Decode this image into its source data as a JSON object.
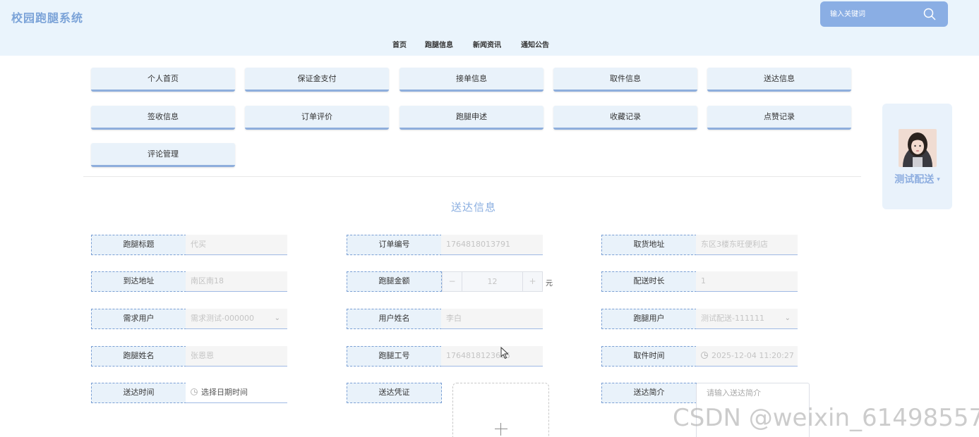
{
  "app": {
    "title": "校园跑腿系统"
  },
  "search": {
    "placeholder": "输入关键词"
  },
  "nav": [
    "首页",
    "跑腿信息",
    "新闻资讯",
    "通知公告"
  ],
  "menu": [
    "个人首页",
    "保证金支付",
    "接单信息",
    "取件信息",
    "送达信息",
    "签收信息",
    "订单评价",
    "跑腿申述",
    "收藏记录",
    "点赞记录",
    "评论管理"
  ],
  "user": {
    "name": "测试配送"
  },
  "form": {
    "title": "送达信息",
    "fields": [
      {
        "label": "跑腿标题",
        "value": "代买"
      },
      {
        "label": "订单编号",
        "value": "1764818013791"
      },
      {
        "label": "取货地址",
        "value": "东区3楼东旺便利店"
      },
      {
        "label": "到达地址",
        "value": "南区南18"
      },
      {
        "label": "跑腿金额",
        "value": "12"
      },
      {
        "label": "配送时长",
        "value": "1"
      },
      {
        "label": "需求用户",
        "value": "需求测试-000000"
      },
      {
        "label": "用户姓名",
        "value": "李白"
      },
      {
        "label": "跑腿用户",
        "value": "测试配送-111111"
      },
      {
        "label": "跑腿姓名",
        "value": "张恩恩"
      },
      {
        "label": "跑腿工号",
        "value": "1764818123605"
      },
      {
        "label": "取件时间",
        "value": "2025-12-04 11:20:27"
      },
      {
        "label": "送达时间",
        "placeholder": "选择日期时间"
      },
      {
        "label": "送达凭证"
      },
      {
        "label": "送达简介",
        "placeholder": "请输入送达简介"
      }
    ],
    "amount_unit": "元",
    "stepper": {
      "minus": "−",
      "plus": "+"
    }
  },
  "watermark": "CSDN @weixin_61498557",
  "colors": {
    "header_bg": "#eaf4fc",
    "accent": "#8aaee4",
    "label_border": "#7a9fd4"
  },
  "icons": {
    "search": "search-icon",
    "upload": "plus-icon",
    "time": "clock-icon",
    "select": "chevron-down-icon"
  }
}
